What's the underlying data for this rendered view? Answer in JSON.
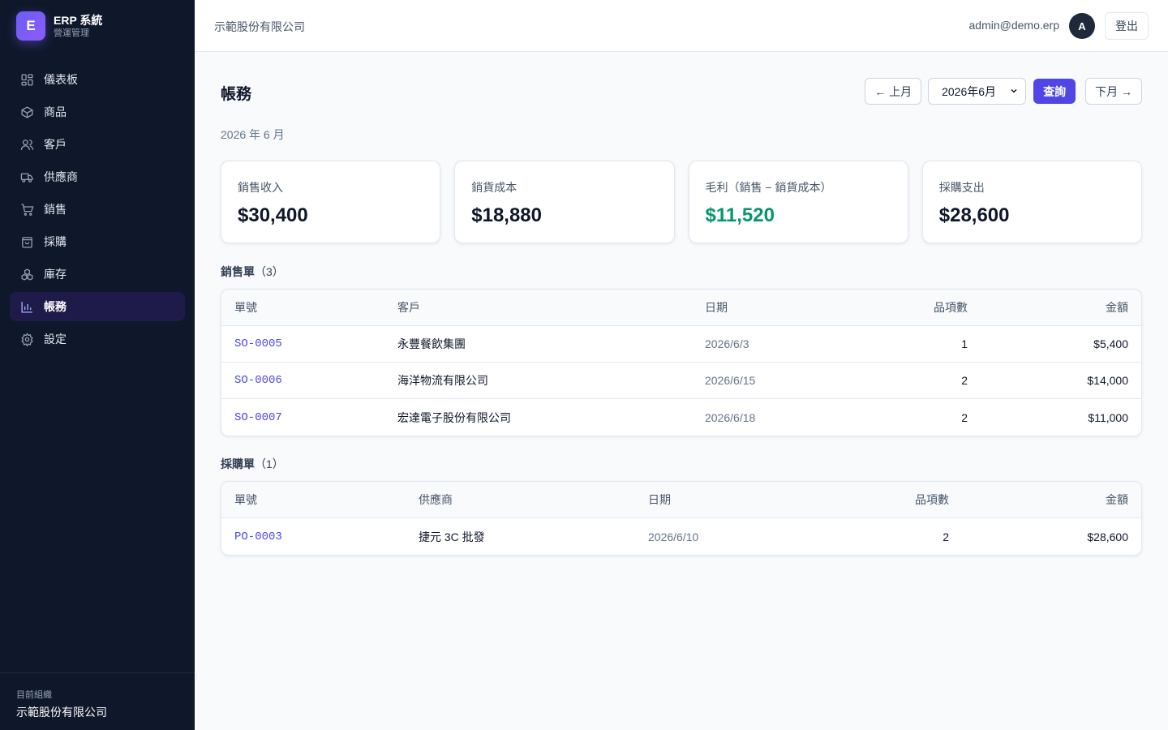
{
  "brand": {
    "logo_letter": "E",
    "title": "ERP 系統",
    "subtitle": "營運管理"
  },
  "sidebar": {
    "items": [
      {
        "label": "儀表板",
        "icon": "dashboard-icon",
        "active": false
      },
      {
        "label": "商品",
        "icon": "box-icon",
        "active": false
      },
      {
        "label": "客戶",
        "icon": "users-icon",
        "active": false
      },
      {
        "label": "供應商",
        "icon": "truck-icon",
        "active": false
      },
      {
        "label": "銷售",
        "icon": "cart-icon",
        "active": false
      },
      {
        "label": "採購",
        "icon": "shopping-bag-icon",
        "active": false
      },
      {
        "label": "庫存",
        "icon": "boxes-icon",
        "active": false
      },
      {
        "label": "帳務",
        "icon": "bar-chart-icon",
        "active": true
      },
      {
        "label": "設定",
        "icon": "gear-icon",
        "active": false
      }
    ],
    "org_label": "目前組織",
    "org_name": "示範股份有限公司"
  },
  "topbar": {
    "company": "示範股份有限公司",
    "user_email": "admin@demo.erp",
    "avatar_letter": "A",
    "logout_label": "登出"
  },
  "page": {
    "title": "帳務",
    "prev_label": "← 上月",
    "month_value": "2026年6月",
    "query_label": "查詢",
    "next_label": "下月 →",
    "period": "2026 年 6 月"
  },
  "stats": [
    {
      "label": "銷售收入",
      "value": "$30,400",
      "highlight": false
    },
    {
      "label": "銷貨成本",
      "value": "$18,880",
      "highlight": false
    },
    {
      "label": "毛利（銷售 − 銷貨成本）",
      "value": "$11,520",
      "highlight": true
    },
    {
      "label": "採購支出",
      "value": "$28,600",
      "highlight": false
    }
  ],
  "sales": {
    "title": "銷售單",
    "count": "（3）",
    "headers": {
      "id": "單號",
      "party": "客戶",
      "date": "日期",
      "items": "品項數",
      "amount": "金額"
    },
    "rows": [
      {
        "id": "SO-0005",
        "party": "永豐餐飲集團",
        "date": "2026/6/3",
        "items": "1",
        "amount": "$5,400"
      },
      {
        "id": "SO-0006",
        "party": "海洋物流有限公司",
        "date": "2026/6/15",
        "items": "2",
        "amount": "$14,000"
      },
      {
        "id": "SO-0007",
        "party": "宏達電子股份有限公司",
        "date": "2026/6/18",
        "items": "2",
        "amount": "$11,000"
      }
    ]
  },
  "purchases": {
    "title": "採購單",
    "count": "（1）",
    "headers": {
      "id": "單號",
      "party": "供應商",
      "date": "日期",
      "items": "品項數",
      "amount": "金額"
    },
    "rows": [
      {
        "id": "PO-0003",
        "party": "捷元 3C 批發",
        "date": "2026/6/10",
        "items": "2",
        "amount": "$28,600"
      }
    ]
  },
  "colors": {
    "accent": "#4f46e5",
    "sidebar_bg": "#0f172a",
    "positive": "#059669"
  }
}
